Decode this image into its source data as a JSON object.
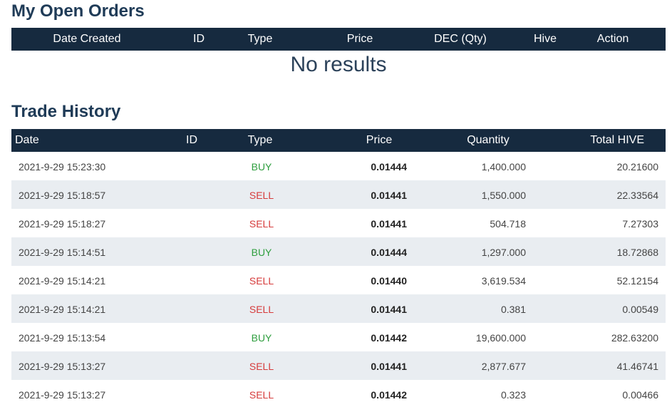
{
  "open_orders": {
    "title": "My Open Orders",
    "columns": [
      "Date Created",
      "ID",
      "Type",
      "Price",
      "DEC (Qty)",
      "Hive",
      "Action"
    ],
    "empty_message": "No results"
  },
  "trade_history": {
    "title": "Trade History",
    "columns": [
      "Date",
      "ID",
      "Type",
      "Price",
      "Quantity",
      "Total HIVE"
    ],
    "rows": [
      {
        "date": "2021-9-29 15:23:30",
        "type": "BUY",
        "price": "0.01444",
        "quantity": "1,400.000",
        "total": "20.21600"
      },
      {
        "date": "2021-9-29 15:18:57",
        "type": "SELL",
        "price": "0.01441",
        "quantity": "1,550.000",
        "total": "22.33564"
      },
      {
        "date": "2021-9-29 15:18:27",
        "type": "SELL",
        "price": "0.01441",
        "quantity": "504.718",
        "total": "7.27303"
      },
      {
        "date": "2021-9-29 15:14:51",
        "type": "BUY",
        "price": "0.01444",
        "quantity": "1,297.000",
        "total": "18.72868"
      },
      {
        "date": "2021-9-29 15:14:21",
        "type": "SELL",
        "price": "0.01440",
        "quantity": "3,619.534",
        "total": "52.12154"
      },
      {
        "date": "2021-9-29 15:14:21",
        "type": "SELL",
        "price": "0.01441",
        "quantity": "0.381",
        "total": "0.00549"
      },
      {
        "date": "2021-9-29 15:13:54",
        "type": "BUY",
        "price": "0.01442",
        "quantity": "19,600.000",
        "total": "282.63200"
      },
      {
        "date": "2021-9-29 15:13:27",
        "type": "SELL",
        "price": "0.01441",
        "quantity": "2,877.677",
        "total": "41.46741"
      },
      {
        "date": "2021-9-29 15:13:27",
        "type": "SELL",
        "price": "0.01442",
        "quantity": "0.323",
        "total": "0.00466"
      }
    ]
  },
  "colors": {
    "header_bg": "#162a3f",
    "title": "#1f3b57",
    "buy": "#2e9e3e",
    "sell": "#d63b3b",
    "row_alt": "#e9edf1"
  }
}
